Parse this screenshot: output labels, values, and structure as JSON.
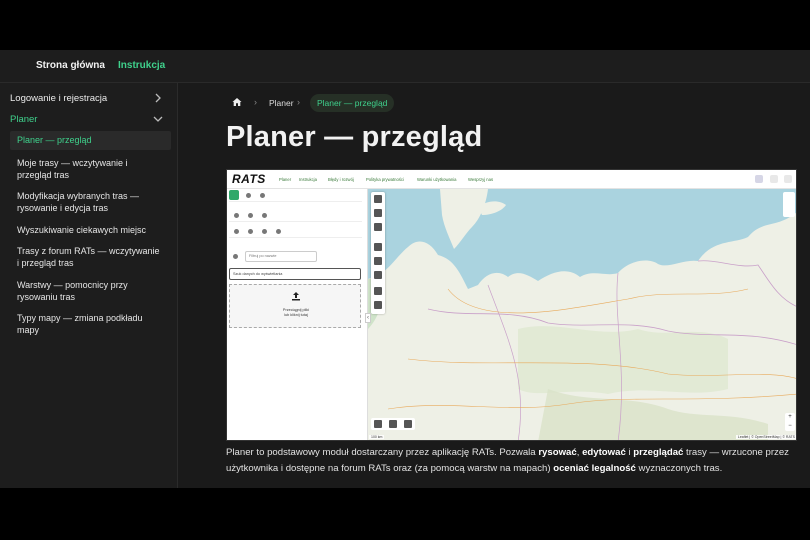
{
  "topnav": {
    "home": "Strona główna",
    "instructions": "Instrukcja"
  },
  "sidebar": {
    "group1": "Logowanie i rejestracja",
    "group2": "Planer",
    "items": [
      "Planer — przegląd",
      "Moje trasy — wczytywanie i przegląd tras",
      "Modyfikacja wybranych tras — rysowanie i edycja tras",
      "Wyszukiwanie ciekawych miejsc",
      "Trasy z forum RATs — wczytywanie i przegląd tras",
      "Warstwy — pomocnicy przy rysowaniu tras",
      "Typy mapy — zmiana podkładu mapy"
    ]
  },
  "breadcrumb": {
    "planer": "Planer",
    "current": "Planer — przegląd"
  },
  "page_title": "Planer — przegląd",
  "screenshot": {
    "logo": "RATS",
    "menu": [
      "Planer",
      "Instrukcja",
      "Błędy i rozwój",
      "Polityka prywatności",
      "Warunki użytkowania",
      "Wesprzyj nas"
    ],
    "filter_placeholder": "Filtruj po nazwie",
    "search_placeholder": "Szuk danych do wyświetlania",
    "drop_line1": "Przeciągnij pliki",
    "drop_line2": "lub kliknij tutaj",
    "scale": "100 km",
    "attribution": "Leaflet | © OpenStreetMap | © RATS",
    "zoom_in": "+",
    "zoom_out": "−"
  },
  "description": {
    "p1": "Planer to podstawowy moduł dostarczany przez aplikację RATs. Pozwala ",
    "b1": "rysować",
    "p2": ", ",
    "b2": "edytować",
    "p3": " i ",
    "b3": "przeglądać",
    "p4": " trasy — wrzucone przez użytkownika i dostępne na forum RATs oraz (za pomocą warstw na mapach) ",
    "b4": "oceniać legalność",
    "p5": " wyznaczonych tras."
  },
  "colors": {
    "accent": "#3fd18c",
    "background": "#1a1a1a",
    "sea": "#aad3df",
    "land": "#eef0e6"
  }
}
